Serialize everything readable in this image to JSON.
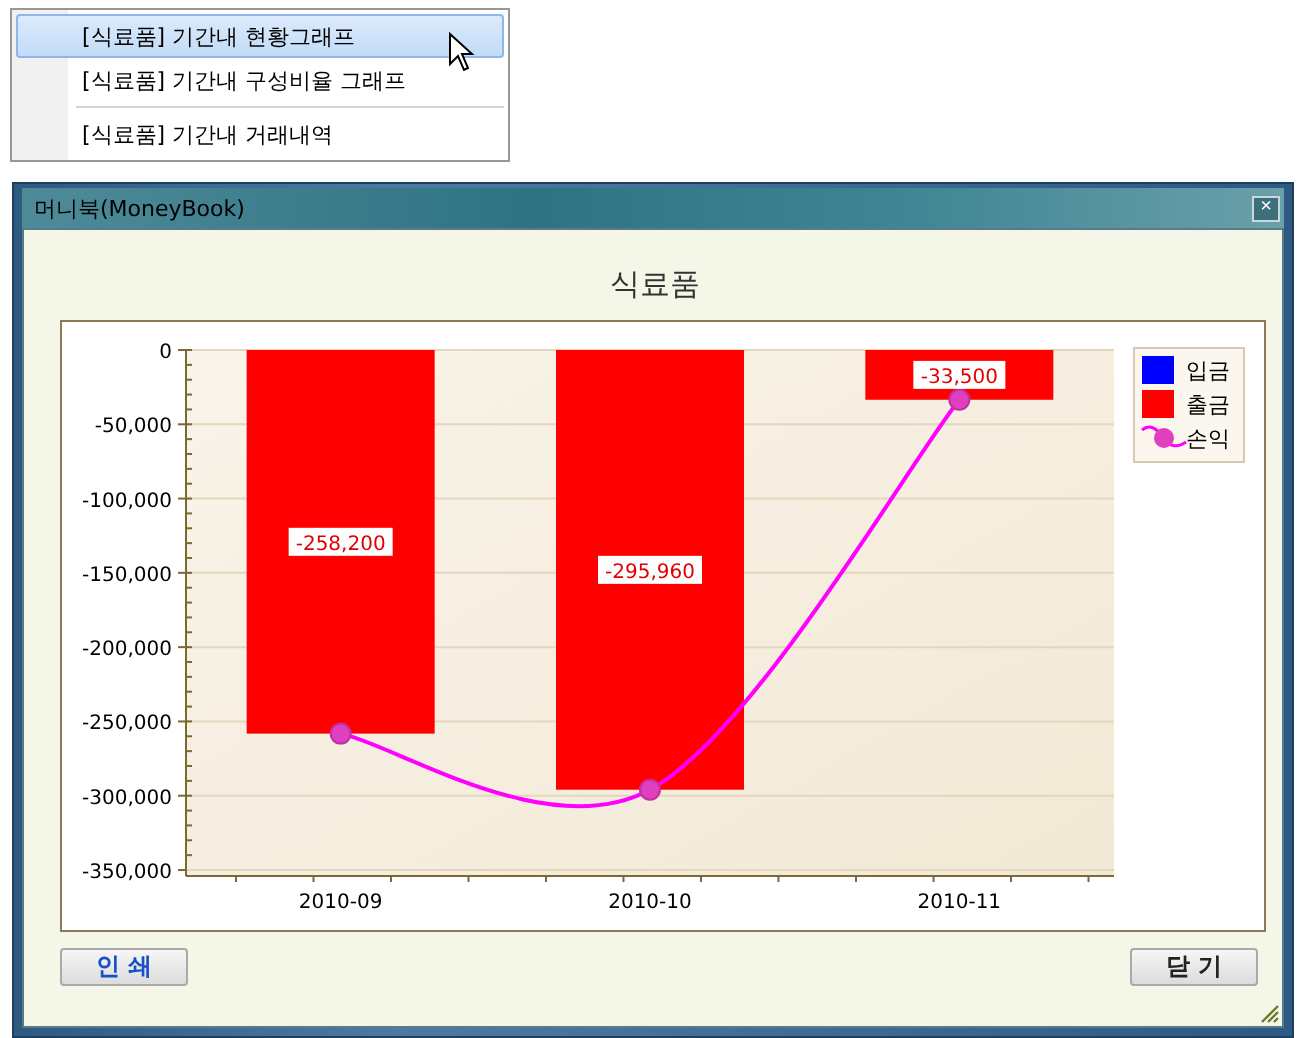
{
  "context_menu": {
    "items": [
      {
        "label": "[식료품] 기간내 현황그래프",
        "selected": true,
        "separator_before": false
      },
      {
        "label": "[식료품] 기간내 구성비율 그래프",
        "selected": false,
        "separator_before": false
      },
      {
        "label": "[식료품] 기간내 거래내역",
        "selected": false,
        "separator_before": true
      }
    ]
  },
  "window": {
    "title": "머니북(MoneyBook)",
    "close_label": "×"
  },
  "chart_title": "식료품",
  "chart_data": {
    "type": "bar",
    "categories": [
      "2010-09",
      "2010-10",
      "2010-11"
    ],
    "series": [
      {
        "name": "입금",
        "color": "#0000ff",
        "type": "bar",
        "values": [
          null,
          null,
          null
        ]
      },
      {
        "name": "출금",
        "color": "#ff0000",
        "type": "bar",
        "values": [
          -258200,
          -295960,
          -33500
        ]
      },
      {
        "name": "손익",
        "color": "#ff00ff",
        "type": "line",
        "marker": "circle",
        "values": [
          -258200,
          -295960,
          -33500
        ]
      }
    ],
    "grid": true,
    "legend": "right",
    "ylim": [
      -350000,
      0
    ],
    "yticks": [
      {
        "value": 0,
        "label": "0"
      },
      {
        "value": -50000,
        "label": "-50,000"
      },
      {
        "value": -100000,
        "label": "-100,000"
      },
      {
        "value": -150000,
        "label": "-150,000"
      },
      {
        "value": -200000,
        "label": "-200,000"
      },
      {
        "value": -250000,
        "label": "-250,000"
      },
      {
        "value": -300000,
        "label": "-300,000"
      },
      {
        "value": -350000,
        "label": "-350,000"
      }
    ],
    "value_labels": [
      "-258,200",
      "-295,960",
      "-33,500"
    ]
  },
  "buttons": [
    {
      "label": "인 쇄",
      "kind": "primary"
    },
    {
      "label": "닫 기",
      "kind": "default"
    }
  ]
}
